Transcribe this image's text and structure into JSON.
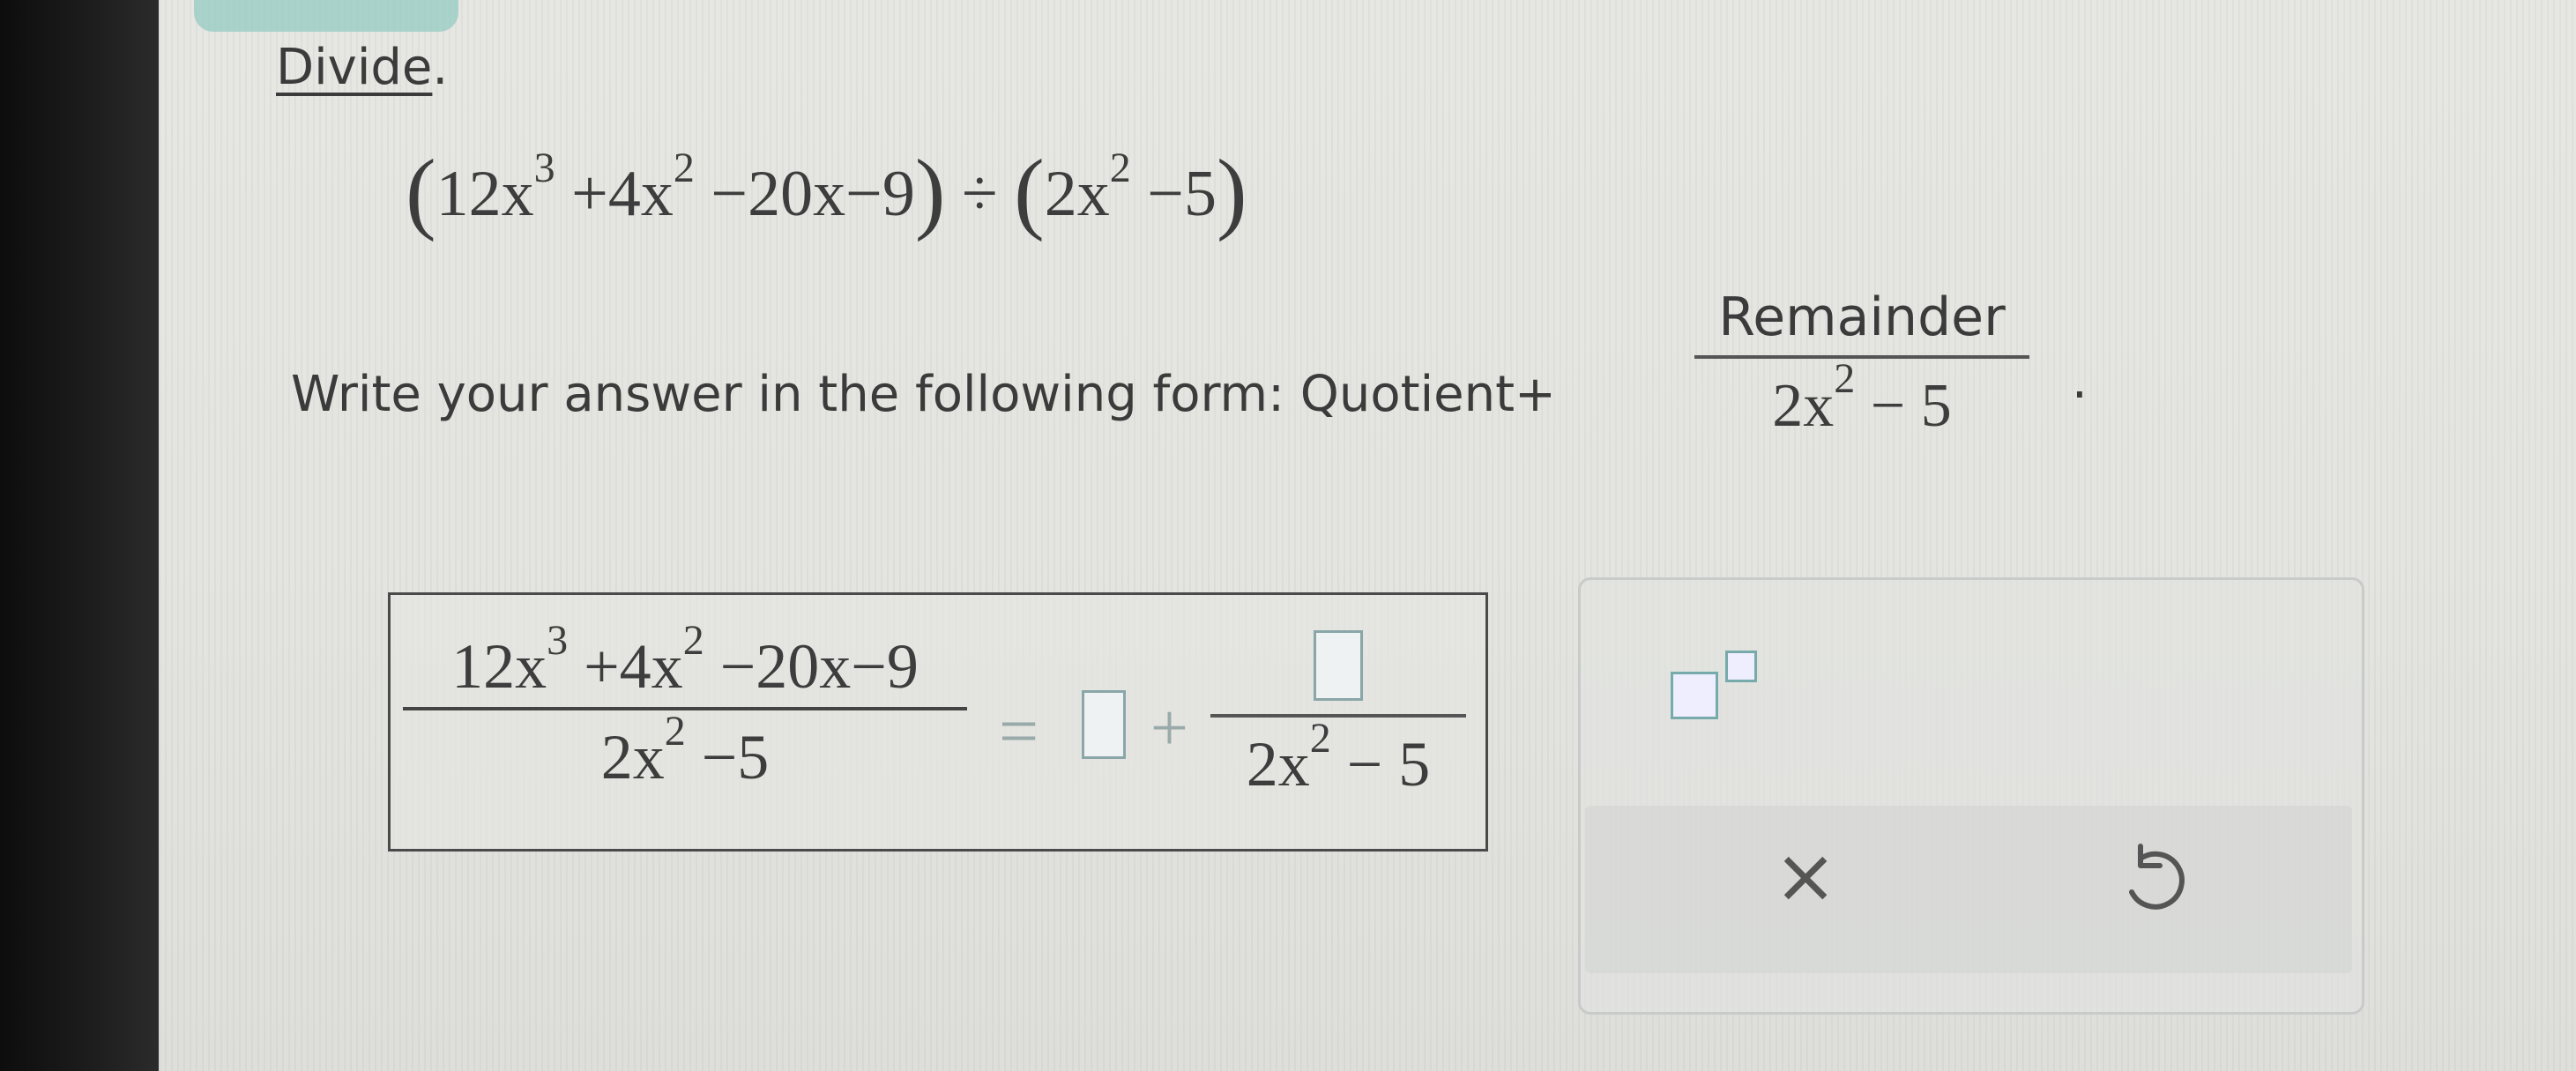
{
  "heading": {
    "text": "Divide",
    "punct": "."
  },
  "problem": {
    "dividend_terms": {
      "a": "12x",
      "a_exp": "3",
      "b": "+4x",
      "b_exp": "2",
      "c": "−20x−9"
    },
    "divide_sign": "÷",
    "divisor": {
      "a": "2x",
      "a_exp": "2",
      "b": "−5"
    }
  },
  "instruction": {
    "text": "Write your answer in the following form: Quotient+",
    "frac_numerator": "Remainder",
    "frac_den_a": "2x",
    "frac_den_exp": "2",
    "frac_den_b": "− 5",
    "period": "."
  },
  "answer": {
    "lhs_num_a": "12x",
    "lhs_num_a_exp": "3",
    "lhs_num_b": "+4x",
    "lhs_num_b_exp": "2",
    "lhs_num_c": "−20x−9",
    "lhs_den_a": "2x",
    "lhs_den_exp": "2",
    "lhs_den_b": "−5",
    "equals": "=",
    "plus": "+",
    "rhs_den_a": "2x",
    "rhs_den_exp": "2",
    "rhs_den_b": "− 5"
  },
  "tools": {
    "clear_label": "×"
  },
  "colors": {
    "input_border": "#8aa6a8",
    "tab_accent": "#8fc9c2"
  }
}
